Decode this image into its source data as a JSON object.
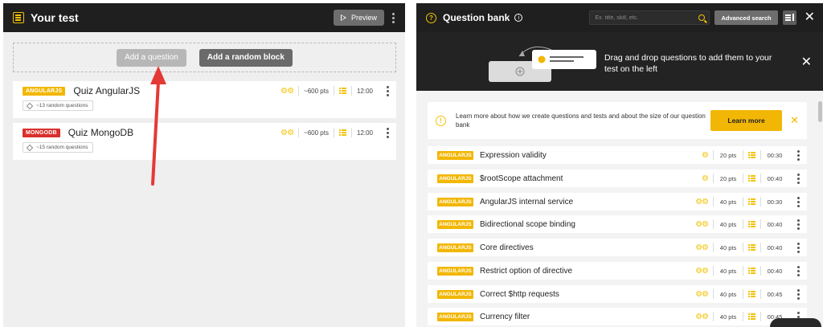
{
  "left_panel": {
    "title": "Your test",
    "preview_label": "Preview",
    "add_question_label": "Add a question",
    "add_random_block_label": "Add a random block",
    "quizzes": [
      {
        "tag": "ANGULARJS",
        "tag_color": "#f2b705",
        "title": "Quiz AngularJS",
        "points": "~600 pts",
        "time": "12:00",
        "random_questions": "~13 random questions"
      },
      {
        "tag": "MONGODB",
        "tag_color": "#d9302c",
        "title": "Quiz MongoDB",
        "points": "~600 pts",
        "time": "12:00",
        "random_questions": "~15 random questions"
      }
    ]
  },
  "right_panel": {
    "title": "Question bank",
    "search_placeholder": "Ex. title, skill, etc.",
    "advanced_search_label": "Advanced search",
    "banner_text": "Drag and drop questions to add them to your test on the left",
    "learn_text": "Learn more about how we create questions and tests and about the size of our question bank",
    "learn_more_label": "Learn more",
    "questions": [
      {
        "tag": "ANGULARJS",
        "title": "Expression validity",
        "gears": "⚙",
        "points": "20 pts",
        "time": "00:30"
      },
      {
        "tag": "ANGULARJS",
        "title": "$rootScope attachment",
        "gears": "⚙",
        "points": "20 pts",
        "time": "00:40"
      },
      {
        "tag": "ANGULARJS",
        "title": "AngularJS internal service",
        "gears": "⚙⚙",
        "points": "40 pts",
        "time": "00:30"
      },
      {
        "tag": "ANGULARJS",
        "title": "Bidirectional scope binding",
        "gears": "⚙⚙",
        "points": "40 pts",
        "time": "00:40"
      },
      {
        "tag": "ANGULARJS",
        "title": "Core directives",
        "gears": "⚙⚙",
        "points": "40 pts",
        "time": "00:40"
      },
      {
        "tag": "ANGULARJS",
        "title": "Restrict option of directive",
        "gears": "⚙⚙",
        "points": "40 pts",
        "time": "00:40"
      },
      {
        "tag": "ANGULARJS",
        "title": "Correct $http requests",
        "gears": "⚙⚙",
        "points": "40 pts",
        "time": "00:45"
      },
      {
        "tag": "ANGULARJS",
        "title": "Currency filter",
        "gears": "⚙⚙",
        "points": "40 pts",
        "time": "00:45"
      }
    ]
  },
  "colors": {
    "accent": "#f2b705",
    "dark": "#1f1f1f",
    "arrow": "#e53935"
  }
}
